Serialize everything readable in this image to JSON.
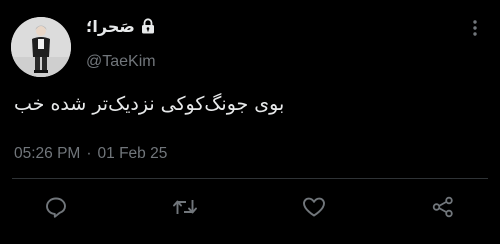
{
  "tweet": {
    "display_name": "صَحرا؛",
    "handle": "@TaeKim",
    "text": "بوی جونگ‌کوکی نزدیک‌تر شده خب",
    "time": "05:26 PM",
    "separator": "·",
    "date": "01 Feb 25",
    "protected": true
  },
  "icons": {
    "lock": "lock-icon",
    "more": "more-vertical-icon",
    "reply": "reply-icon",
    "retweet": "retweet-icon",
    "like": "heart-icon",
    "share": "share-icon"
  },
  "colors": {
    "background": "#000000",
    "text_primary": "#e7e9ea",
    "text_secondary": "#71767b",
    "divider": "#2f3336",
    "icon": "#71767b"
  }
}
